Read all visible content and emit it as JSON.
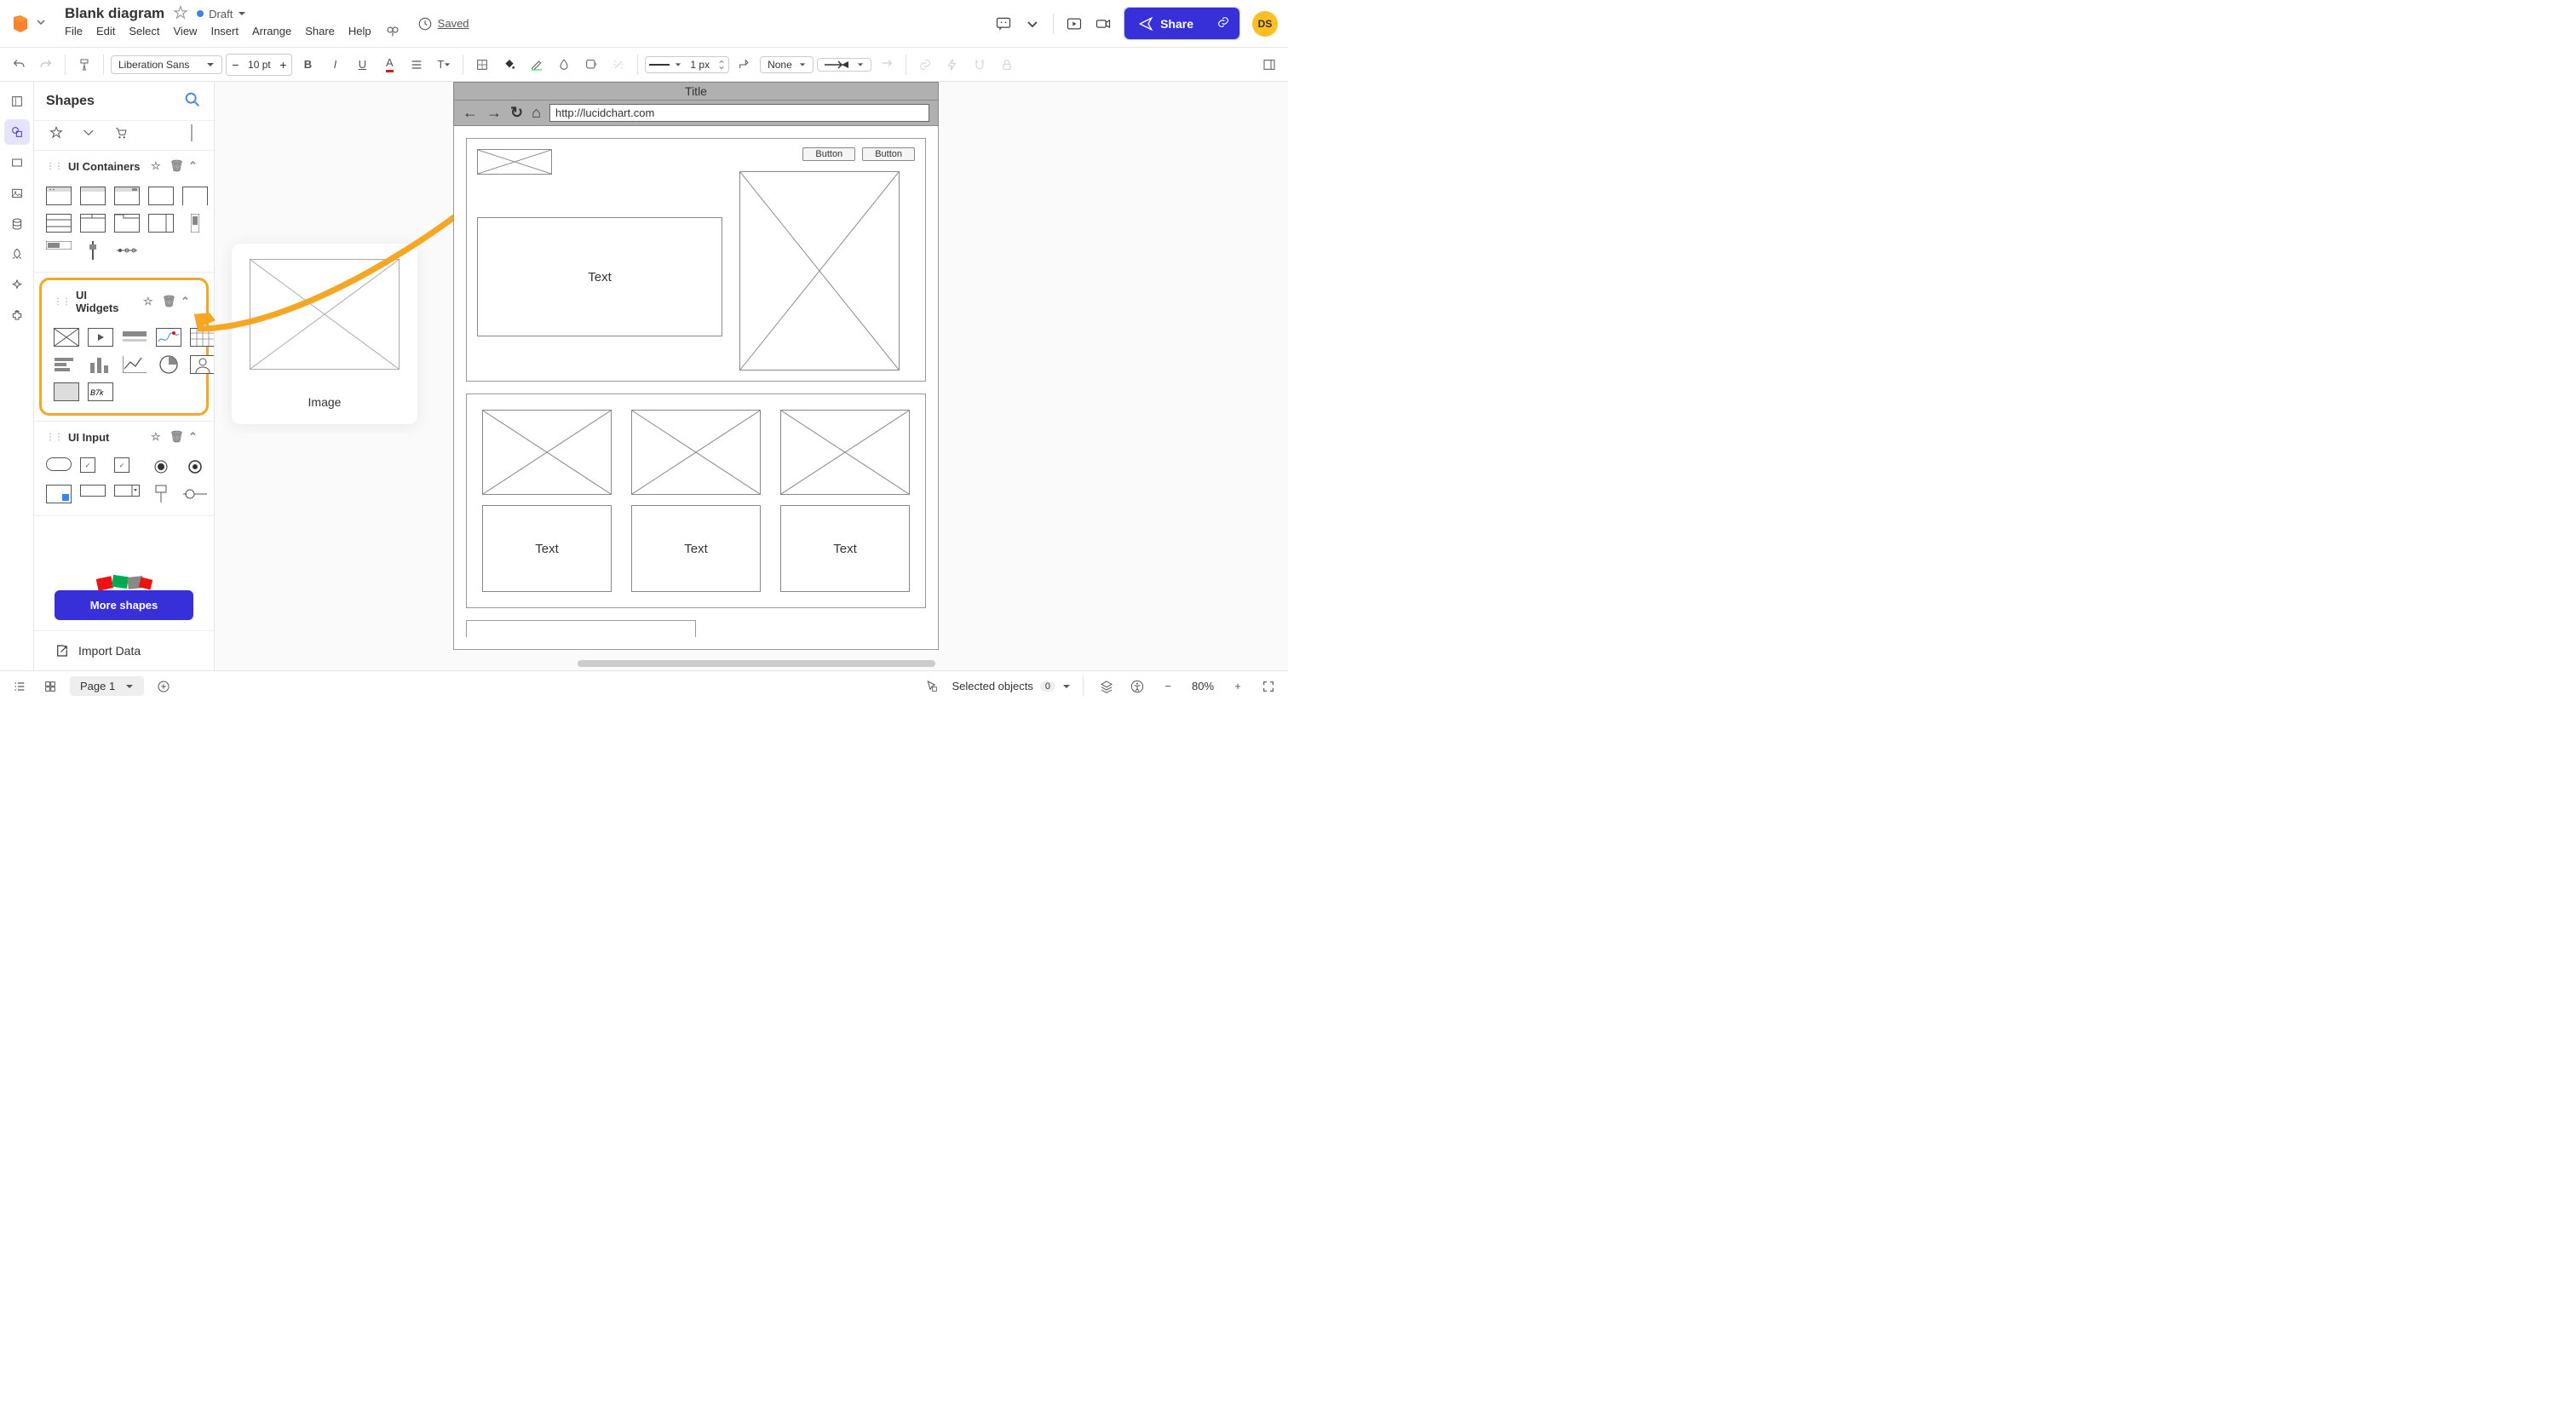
{
  "header": {
    "doc_title": "Blank diagram",
    "status": "Draft",
    "menu": [
      "File",
      "Edit",
      "Select",
      "View",
      "Insert",
      "Arrange",
      "Share",
      "Help"
    ],
    "saved": "Saved",
    "share_label": "Share",
    "avatar_initials": "DS"
  },
  "toolbar": {
    "font": "Liberation Sans",
    "font_size": "10 pt",
    "line_width": "1 px",
    "arrow_start": "None"
  },
  "shapes_panel": {
    "title": "Shapes",
    "sections": {
      "containers": "UI Containers",
      "widgets": "UI Widgets",
      "input": "UI Input"
    },
    "more_shapes": "More shapes",
    "import_data": "Import Data"
  },
  "floating_tooltip": {
    "label": "Image"
  },
  "wireframe": {
    "title": "Title",
    "url": "http://lucidchart.com",
    "button1": "Button",
    "button2": "Button",
    "text_main": "Text",
    "card_texts": [
      "Text",
      "Text",
      "Text"
    ]
  },
  "footer": {
    "page_label": "Page 1",
    "selected_label": "Selected objects",
    "selected_count": "0",
    "zoom": "80%"
  }
}
